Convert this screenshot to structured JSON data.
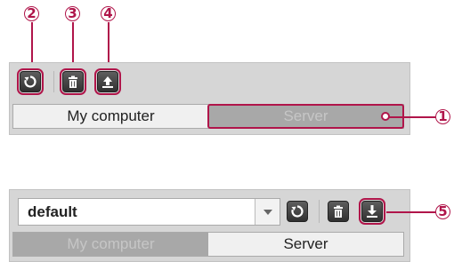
{
  "callouts": [
    "2",
    "3",
    "4",
    "1",
    "5"
  ],
  "panel_top": {
    "toolbar": {
      "buttons": [
        {
          "icon": "refresh-icon"
        },
        {
          "icon": "trash-icon"
        },
        {
          "icon": "upload-icon"
        }
      ]
    },
    "tabs": {
      "my_computer": "My computer",
      "server": "Server",
      "active": "my_computer"
    }
  },
  "panel_bottom": {
    "profile_select": {
      "value": "default"
    },
    "toolbar": {
      "buttons": [
        {
          "icon": "refresh-icon"
        },
        {
          "icon": "trash-icon"
        },
        {
          "icon": "download-icon"
        }
      ]
    },
    "tabs": {
      "my_computer": "My computer",
      "server": "Server",
      "active": "server"
    }
  },
  "colors": {
    "callout": "#b0154a",
    "button": "#3a3a3a",
    "panel": "#d6d6d6"
  }
}
